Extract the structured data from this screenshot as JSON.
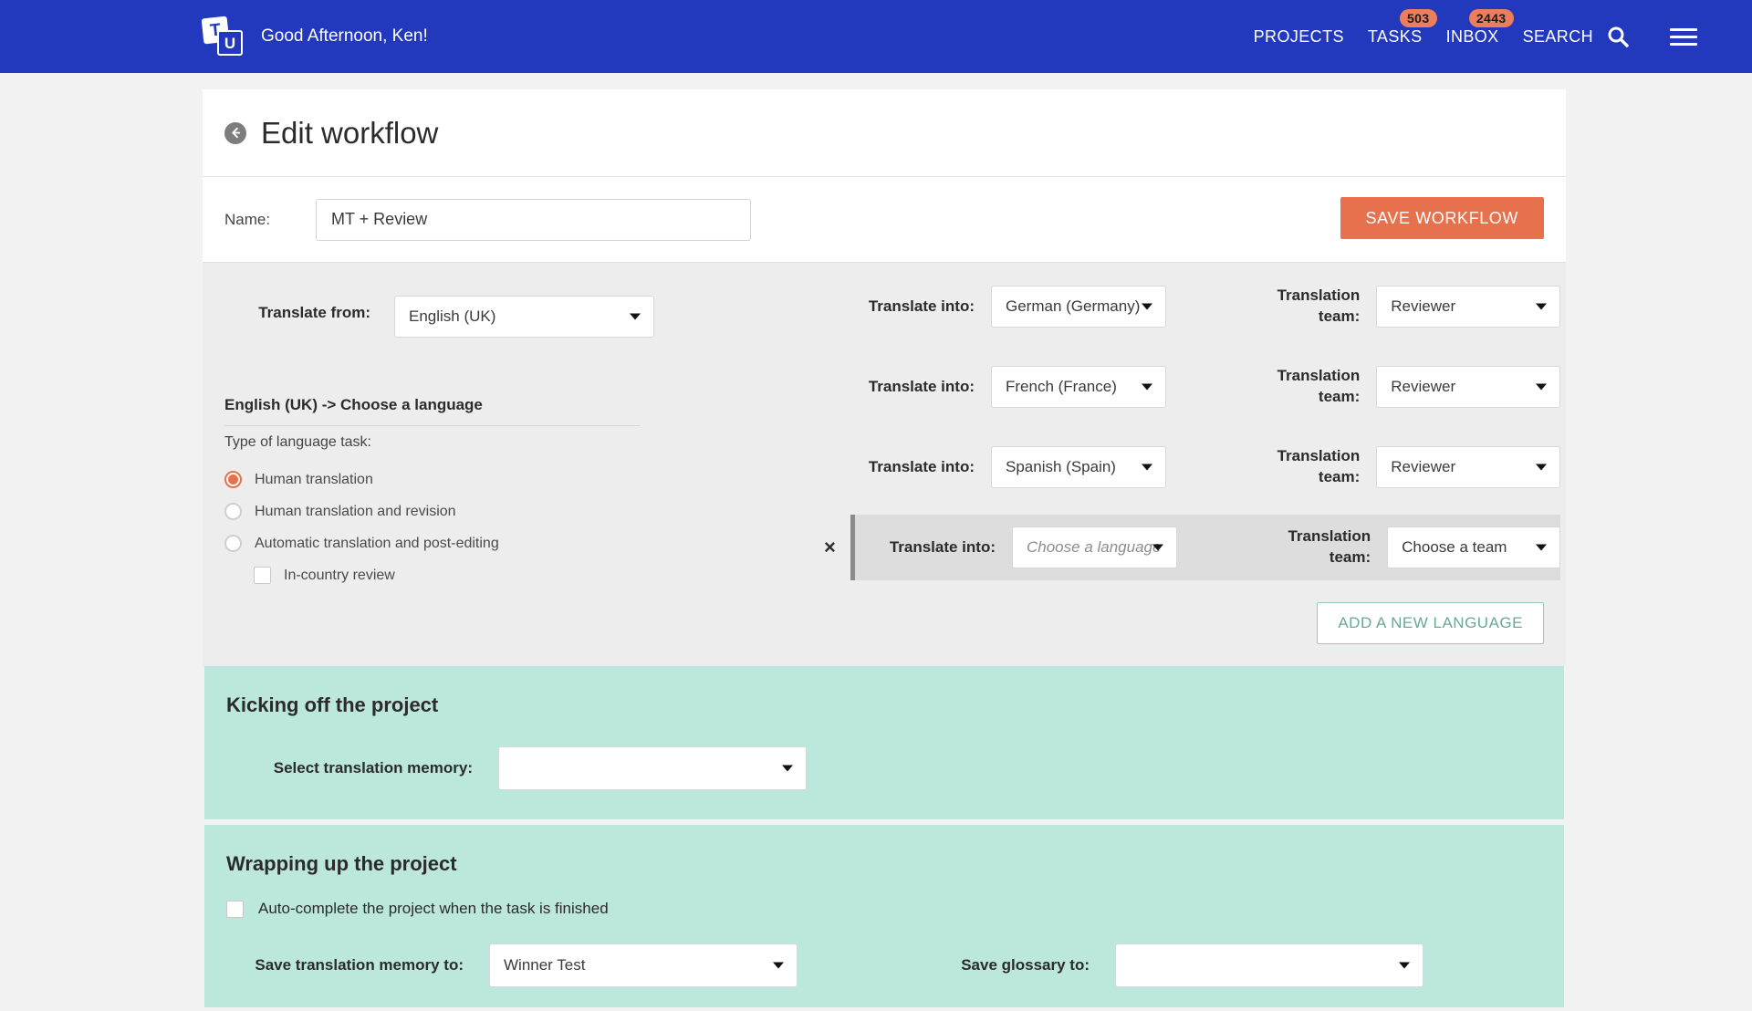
{
  "topnav": {
    "logo": {
      "letter_a": "T",
      "letter_b": "U",
      "name": "tu-logo"
    },
    "greeting": "Good Afternoon, Ken!",
    "items": [
      {
        "label": "PROJECTS",
        "badge": null
      },
      {
        "label": "TASKS",
        "badge": "503"
      },
      {
        "label": "INBOX",
        "badge": "2443"
      },
      {
        "label": "SEARCH",
        "badge": null
      }
    ],
    "search_icon": "search-icon",
    "menu_icon": "hamburger-menu-icon",
    "bg_color": "#2239BE",
    "badge_color": "#ED7E5C"
  },
  "header": {
    "back_icon": "back-arrow-icon",
    "title": "Edit workflow"
  },
  "name_row": {
    "label": "Name:",
    "value": "MT + Review",
    "placeholder": "",
    "save_label": "SAVE WORKFLOW",
    "save_color": "#E8714D"
  },
  "language_section": {
    "translate_from_label": "Translate from:",
    "translate_from_value": "English (UK)",
    "sub_heading": "English (UK) -> Choose a language",
    "task_type_label": "Type of language task:",
    "radios": [
      {
        "label": "Human translation",
        "selected": true
      },
      {
        "label": "Human translation and revision",
        "selected": false
      },
      {
        "label": "Automatic translation and post-editing",
        "selected": false
      }
    ],
    "in_country_review": {
      "label": "In-country review",
      "checked": false
    },
    "into_label": "Translate into:",
    "team_label": "Translation team:",
    "rows": [
      {
        "language": "German (Germany)",
        "team": "Reviewer",
        "highlighted": false,
        "placeholder_lang": false,
        "removable": false
      },
      {
        "language": "French (France)",
        "team": "Reviewer",
        "highlighted": false,
        "placeholder_lang": false,
        "removable": false
      },
      {
        "language": "Spanish (Spain)",
        "team": "Reviewer",
        "highlighted": false,
        "placeholder_lang": false,
        "removable": false
      },
      {
        "language": "Choose a language",
        "team": "Choose a team",
        "highlighted": true,
        "placeholder_lang": true,
        "removable": true
      }
    ],
    "remove_icon": "×",
    "add_language_label": "ADD A NEW LANGUAGE",
    "add_language_color": "#6aa79a"
  },
  "kickoff": {
    "title": "Kicking off the project",
    "tm_label": "Select translation memory:",
    "tm_value": ""
  },
  "wrapup": {
    "title": "Wrapping up the project",
    "autocomplete": {
      "label": "Auto-complete the project when the task is finished",
      "checked": false
    },
    "save_tm_label": "Save translation memory to:",
    "save_tm_value": "Winner Test",
    "save_glossary_label": "Save glossary to:",
    "save_glossary_value": ""
  }
}
